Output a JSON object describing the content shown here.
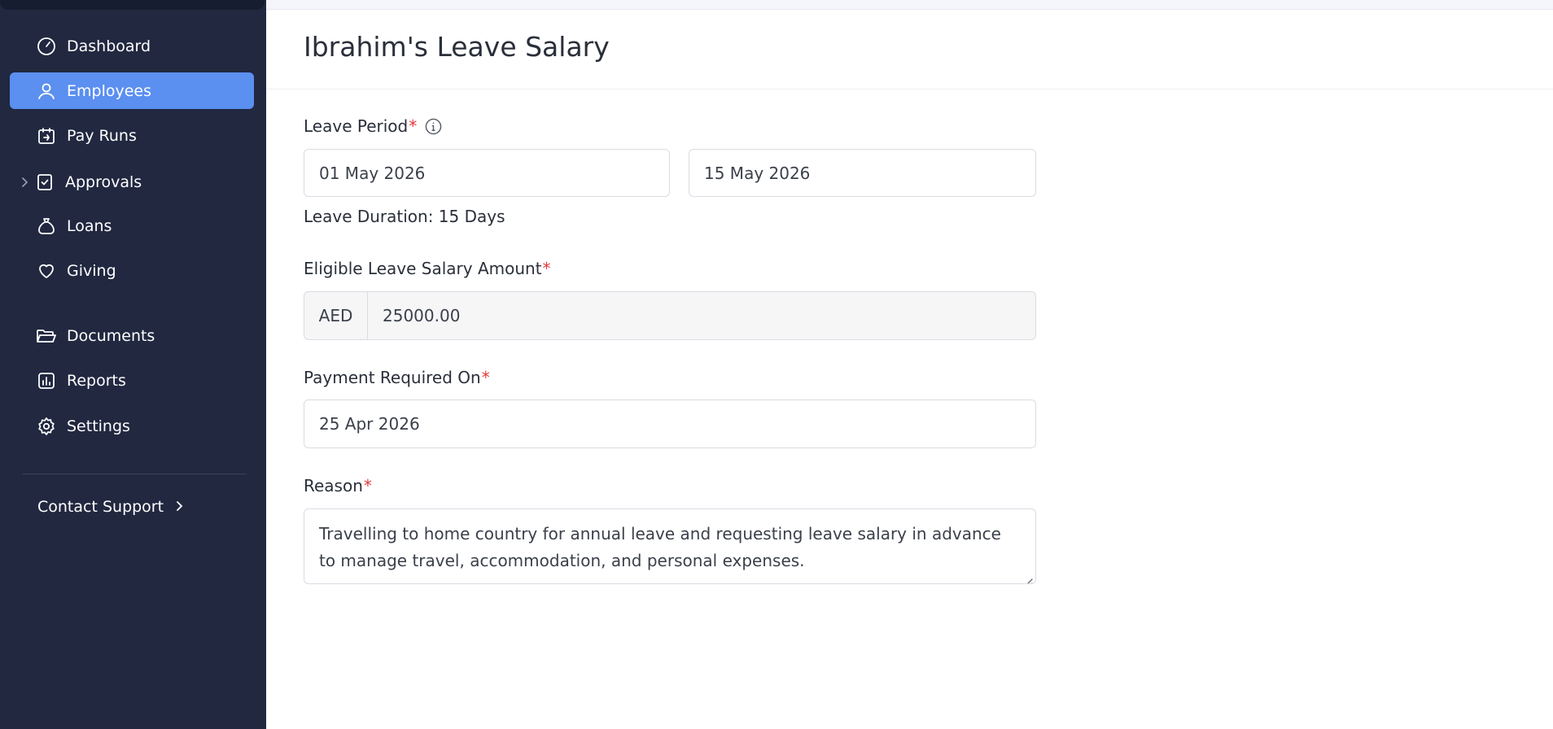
{
  "sidebar": {
    "items": [
      {
        "label": "Dashboard",
        "icon": "gauge-icon"
      },
      {
        "label": "Employees",
        "icon": "user-icon",
        "active": true
      },
      {
        "label": "Pay Runs",
        "icon": "calendar-icon"
      },
      {
        "label": "Approvals",
        "icon": "checkbox-icon",
        "expandable": true
      },
      {
        "label": "Loans",
        "icon": "money-bag-icon"
      },
      {
        "label": "Giving",
        "icon": "heart-icon"
      },
      {
        "label": "Documents",
        "icon": "folder-icon"
      },
      {
        "label": "Reports",
        "icon": "report-icon"
      },
      {
        "label": "Settings",
        "icon": "gear-icon"
      }
    ],
    "support_label": "Contact Support"
  },
  "page": {
    "title": "Ibrahim's Leave Salary"
  },
  "form": {
    "leave_period": {
      "label": "Leave Period",
      "required_mark": "*",
      "start_date": "01 May 2026",
      "end_date": "15 May 2026"
    },
    "leave_duration": "Leave Duration: 15 Days",
    "eligible_amount": {
      "label": "Eligible Leave Salary Amount",
      "required_mark": "*",
      "currency": "AED",
      "value": "25000.00"
    },
    "payment_required_on": {
      "label": "Payment Required On",
      "required_mark": "*",
      "value": "25 Apr 2026"
    },
    "reason": {
      "label": "Reason",
      "required_mark": "*",
      "value": "Travelling to home country for annual leave and requesting leave salary in advance to manage travel, accommodation, and personal expenses."
    }
  },
  "colors": {
    "sidebar_bg": "#212840",
    "active_item": "#5b8ff0",
    "required": "#e5383b"
  }
}
